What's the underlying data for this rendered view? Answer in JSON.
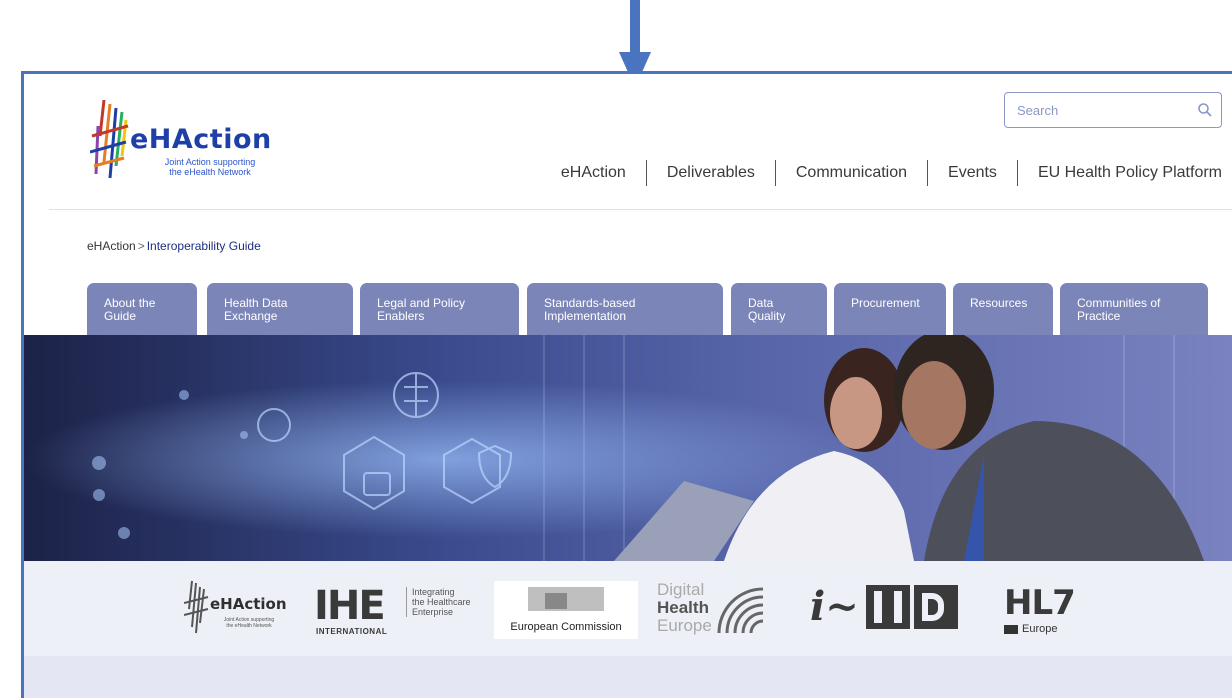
{
  "header": {
    "logo": {
      "title": "eHAction",
      "subtitle_line1": "Joint Action supporting",
      "subtitle_line2": "the eHealth Network"
    },
    "search": {
      "placeholder": "Search",
      "icon": "search-icon"
    },
    "nav": [
      {
        "label": "eHAction"
      },
      {
        "label": "Deliverables"
      },
      {
        "label": "Communication"
      },
      {
        "label": "Events"
      },
      {
        "label": "EU Health Policy Platform"
      }
    ]
  },
  "breadcrumb": {
    "root": "eHAction",
    "separator": ">",
    "current": "Interoperability Guide"
  },
  "tabs": [
    {
      "line1": "About the",
      "line2": "Guide"
    },
    {
      "line1": "Health Data",
      "line2": "Exchange"
    },
    {
      "line1": "Legal and Policy",
      "line2": "Enablers"
    },
    {
      "line1": "Standards-based",
      "line2": "Implementation"
    },
    {
      "line1": "Data",
      "line2": "Quality"
    },
    {
      "line1": "Procurement",
      "line2": ""
    },
    {
      "line1": "Resources",
      "line2": ""
    },
    {
      "line1": "Communities of",
      "line2": "Practice"
    }
  ],
  "partners": {
    "ehaction": {
      "name": "eHAction",
      "sub1": "Joint Action supporting",
      "sub2": "the eHealth Network"
    },
    "ihe": {
      "name": "IHE",
      "sub": "INTERNATIONAL",
      "desc1": "Integrating",
      "desc2": "the Healthcare",
      "desc3": "Enterprise"
    },
    "ec": {
      "name": "European Commission"
    },
    "dhe": {
      "line1": "Digital",
      "line2": "Health",
      "line3": "Europe"
    },
    "ihd": {
      "prefix": "i~",
      "name": "HD"
    },
    "hl7": {
      "name": "HL7",
      "sub": "Europe"
    }
  },
  "colors": {
    "accent_blue": "#4a74c0",
    "tab_bg": "#7b85b8",
    "logo_blue": "#1f3fa8",
    "breadcrumb_current": "#1f2f80",
    "logos_band": "#eef0f7"
  }
}
